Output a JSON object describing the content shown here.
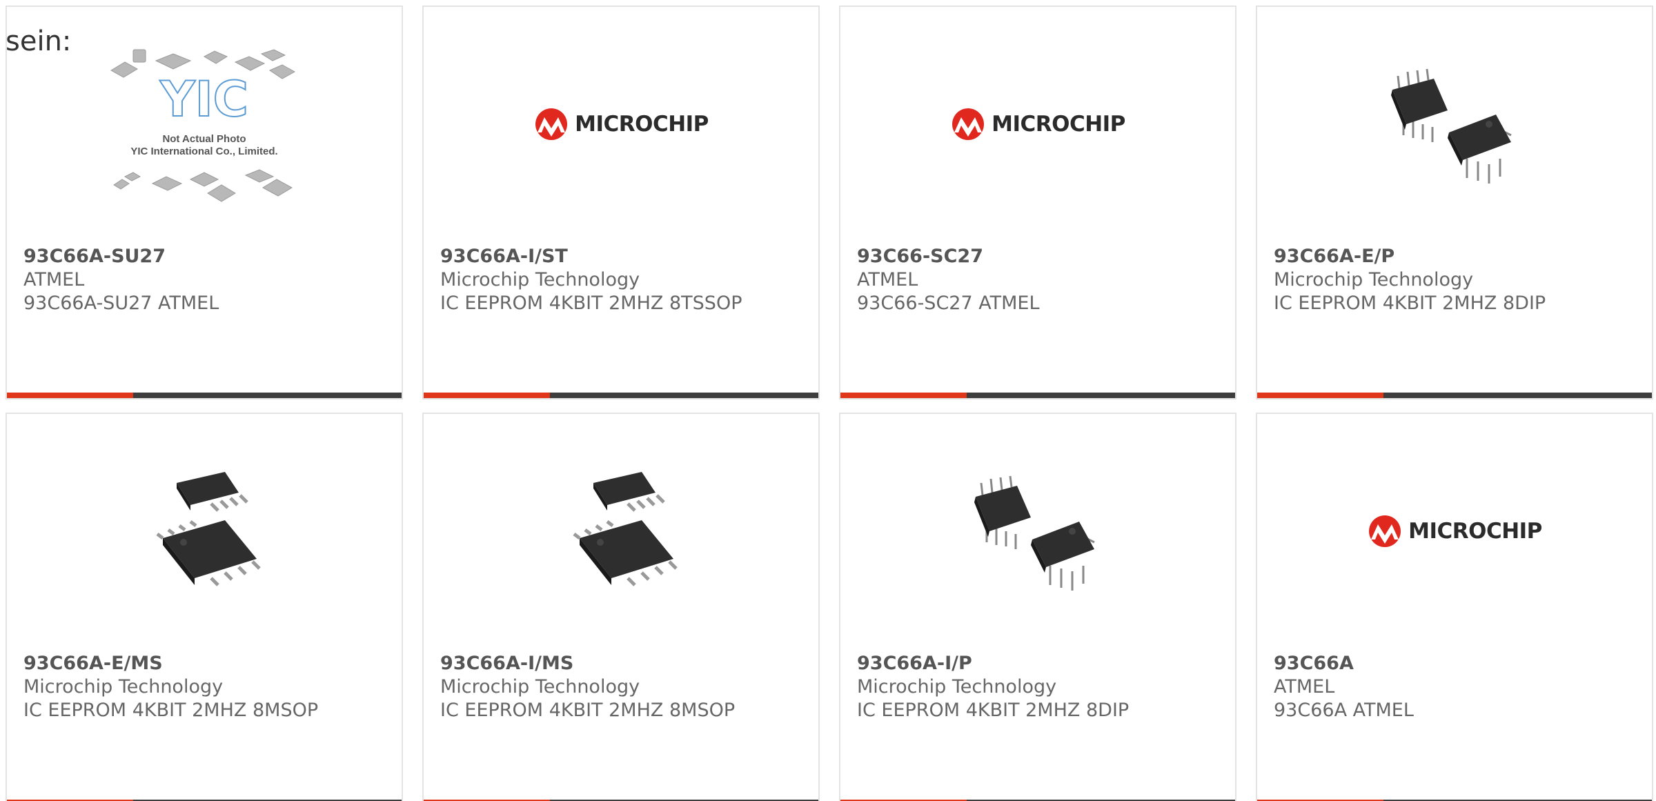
{
  "intro_text": "sein:",
  "colors": {
    "accent": "#e0371a",
    "bar": "#3d3d3d",
    "card_border": "#e3e3e3",
    "text": "#666666",
    "microchip_red": "#e0281f"
  },
  "placeholder": {
    "line1": "Not Actual Photo",
    "line2": "YIC International Co., Limited.",
    "logo": "YIC"
  },
  "brand_logo_text": "MICROCHIP",
  "products": [
    {
      "part": "93C66A-SU27",
      "maker": "ATMEL",
      "desc": "93C66A-SU27 ATMEL",
      "image": "not-actual-photo"
    },
    {
      "part": "93C66A-I/ST",
      "maker": "Microchip Technology",
      "desc": "IC EEPROM 4KBIT 2MHZ 8TSSOP",
      "image": "microchip-logo"
    },
    {
      "part": "93C66-SC27",
      "maker": "ATMEL",
      "desc": "93C66-SC27 ATMEL",
      "image": "microchip-logo"
    },
    {
      "part": "93C66A-E/P",
      "maker": "Microchip Technology",
      "desc": "IC EEPROM 4KBIT 2MHZ 8DIP",
      "image": "dip-8-chips"
    },
    {
      "part": "93C66A-E/MS",
      "maker": "Microchip Technology",
      "desc": "IC EEPROM 4KBIT 2MHZ 8MSOP",
      "image": "msop-8-chips"
    },
    {
      "part": "93C66A-I/MS",
      "maker": "Microchip Technology",
      "desc": "IC EEPROM 4KBIT 2MHZ 8MSOP",
      "image": "msop-8-chips"
    },
    {
      "part": "93C66A-I/P",
      "maker": "Microchip Technology",
      "desc": "IC EEPROM 4KBIT 2MHZ 8DIP",
      "image": "dip-8-chips"
    },
    {
      "part": "93C66A",
      "maker": "ATMEL",
      "desc": "93C66A ATMEL",
      "image": "microchip-logo"
    }
  ]
}
